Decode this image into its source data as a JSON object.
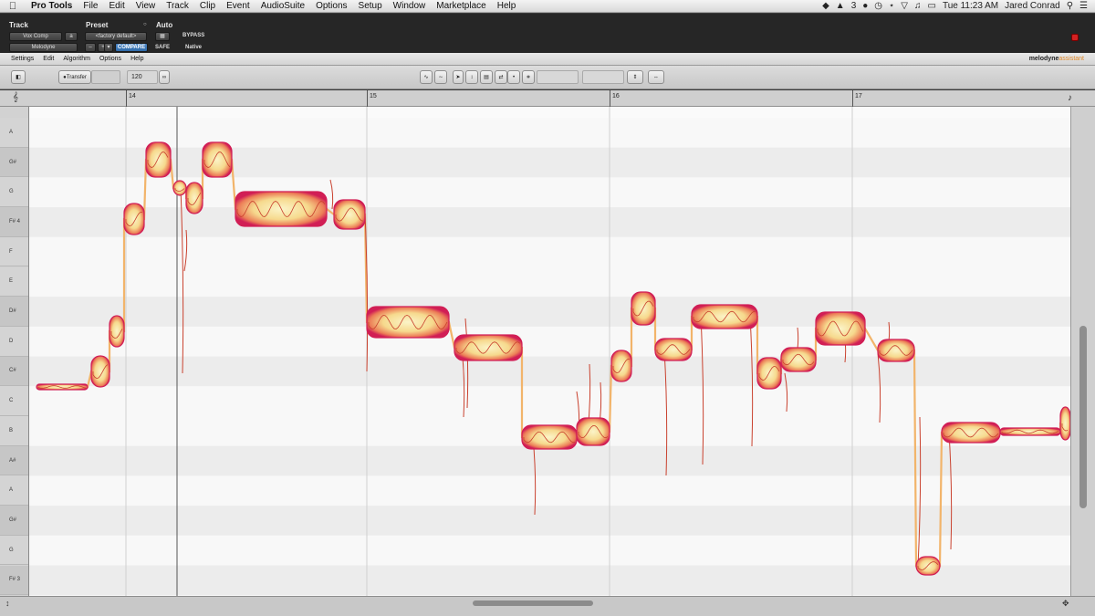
{
  "menubar": {
    "app": "Pro Tools",
    "items": [
      "File",
      "Edit",
      "View",
      "Track",
      "Clip",
      "Event",
      "AudioSuite",
      "Options",
      "Setup",
      "Window",
      "Marketplace",
      "Help"
    ],
    "status": {
      "badge": "3",
      "clock": "Tue 11:23 AM",
      "user": "Jared Conrad"
    }
  },
  "plugin": {
    "track_label": "Track",
    "preset_label": "Preset",
    "auto_label": "Auto",
    "track_name": "Vox Comp",
    "track_slot": "a",
    "plugin_name": "Melodyne",
    "preset_value": "<factory default>",
    "compare": "COMPARE",
    "bypass": "BYPASS",
    "safe": "SAFE",
    "native": "Native"
  },
  "melodyne_menu": {
    "items": [
      "Settings",
      "Edit",
      "Algorithm",
      "Options",
      "Help"
    ],
    "logo_main": "melodyne",
    "logo_sub": "assistant"
  },
  "toolbar": {
    "transfer": "Transfer",
    "tempo": "120"
  },
  "ruler": {
    "bars": [
      "14",
      "15",
      "16",
      "17"
    ]
  },
  "keys": [
    "A",
    "G#",
    "G",
    "F# 4",
    "F",
    "E",
    "D#",
    "D",
    "C#",
    "C",
    "B",
    "A#",
    "A",
    "G#",
    "G",
    "F# 3"
  ],
  "colors": {
    "blob_core": "#f7e7a6",
    "blob_edge": "#d11e55",
    "pitch_line": "#f2b46a",
    "pitch_trace": "#c9412e",
    "stripe_light": "#f8f8f8",
    "stripe_dark": "#ececec"
  }
}
